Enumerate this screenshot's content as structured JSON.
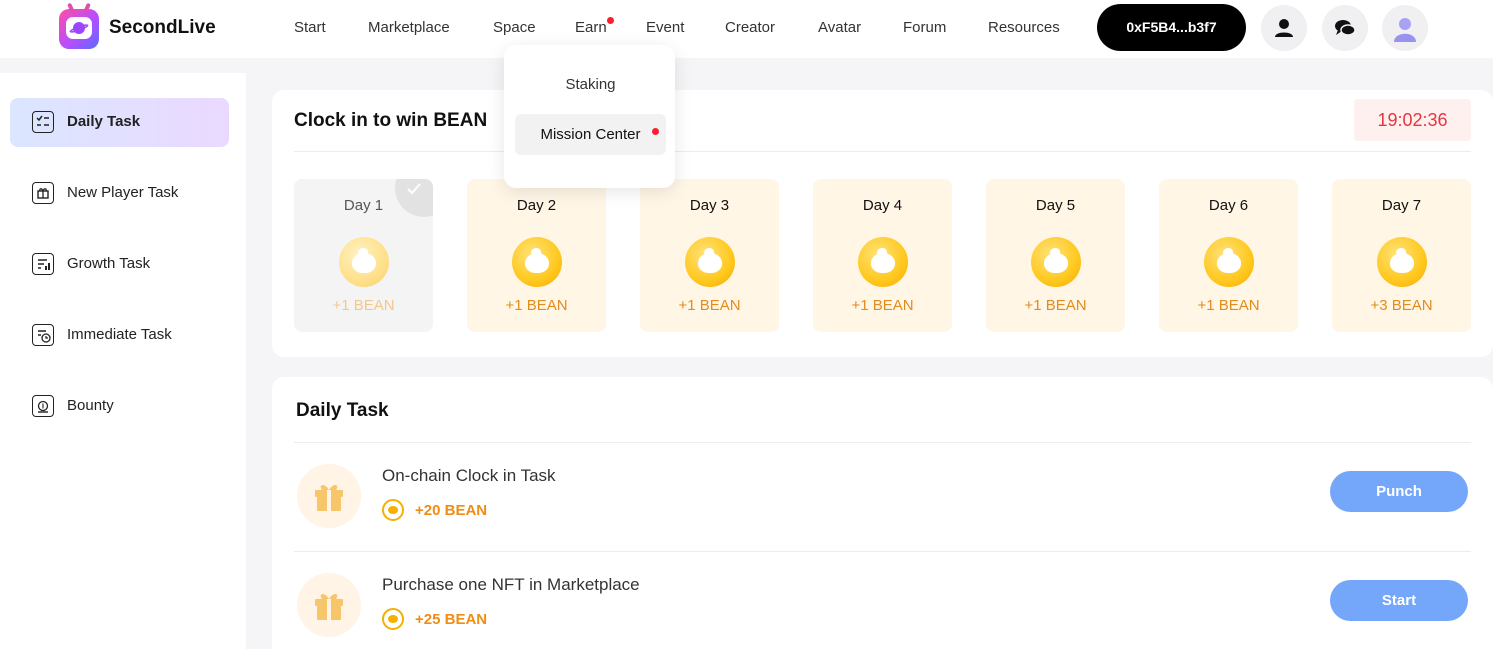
{
  "header": {
    "brand": "SecondLive",
    "nav": [
      {
        "label": "Start"
      },
      {
        "label": "Marketplace"
      },
      {
        "label": "Space"
      },
      {
        "label": "Earn",
        "has_dot": true
      },
      {
        "label": "Event"
      },
      {
        "label": "Creator"
      },
      {
        "label": "Avatar"
      },
      {
        "label": "Forum"
      },
      {
        "label": "Resources"
      }
    ],
    "wallet": "0xF5B4...b3f7",
    "icons": [
      "user-icon",
      "chat-icon",
      "avatar-icon"
    ]
  },
  "earn_dropdown": {
    "items": [
      {
        "label": "Staking"
      },
      {
        "label": "Mission Center",
        "has_dot": true
      }
    ]
  },
  "sidebar": {
    "items": [
      {
        "label": "Daily Task",
        "icon": "checklist-icon",
        "active": true
      },
      {
        "label": "New Player Task",
        "icon": "gift-box-icon"
      },
      {
        "label": "Growth Task",
        "icon": "growth-chart-icon"
      },
      {
        "label": "Immediate Task",
        "icon": "clock-document-icon"
      },
      {
        "label": "Bounty",
        "icon": "money-bag-icon"
      }
    ]
  },
  "clock_in": {
    "title": "Clock in to win BEAN",
    "timer": "19:02:36",
    "days": [
      {
        "label": "Day 1",
        "reward": "+1 BEAN",
        "claimed": true
      },
      {
        "label": "Day 2",
        "reward": "+1 BEAN"
      },
      {
        "label": "Day 3",
        "reward": "+1 BEAN"
      },
      {
        "label": "Day 4",
        "reward": "+1 BEAN"
      },
      {
        "label": "Day 5",
        "reward": "+1 BEAN"
      },
      {
        "label": "Day 6",
        "reward": "+1 BEAN"
      },
      {
        "label": "Day 7",
        "reward": "+3 BEAN"
      }
    ]
  },
  "daily_task": {
    "title": "Daily Task",
    "tasks": [
      {
        "name": "On-chain Clock in Task",
        "reward": "+20 BEAN",
        "button": "Punch"
      },
      {
        "name": "Purchase one NFT in Marketplace",
        "reward": "+25 BEAN",
        "button": "Start"
      }
    ]
  },
  "colors": {
    "accent_blue": "#74a7f9",
    "bean_orange": "#ef8d16",
    "timer_red": "#e8343c",
    "notification_dot": "#f5222d"
  }
}
